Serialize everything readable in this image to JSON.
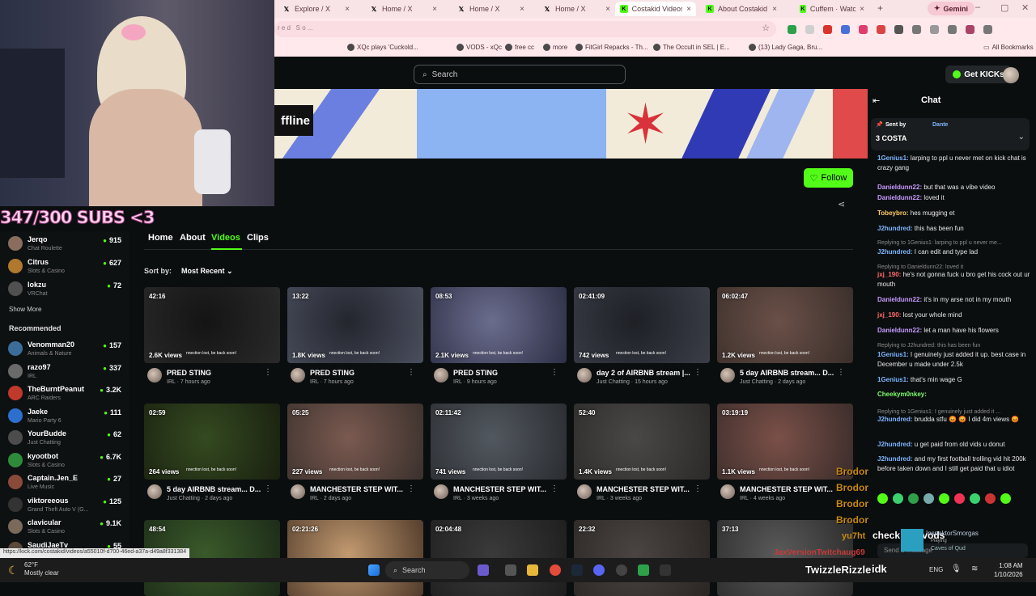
{
  "tabs": [
    {
      "label": "Explore / X",
      "icon": "x-icon"
    },
    {
      "label": "Home / X",
      "icon": "x-icon"
    },
    {
      "label": "Home / X",
      "icon": "x-icon"
    },
    {
      "label": "Home / X",
      "icon": "x-icon"
    },
    {
      "label": "Costakid Videos",
      "icon": "kick-icon"
    },
    {
      "label": "About Costakid",
      "icon": "kick-icon"
    },
    {
      "label": "Cuffem · Watch cl",
      "icon": "kick-icon"
    }
  ],
  "gemini_label": "Gemini",
  "bookmarks": [
    "XQc plays 'Cuckold...",
    "VODS - xQc",
    "free cc",
    "more",
    "FitGirl Repacks - Th...",
    "The Occult in SEL | E...",
    "(13) Lady Gaga, Bru...",
    "All Bookmarks"
  ],
  "search_placeholder": "Search",
  "get_kicks": "Get KICKs",
  "offline_text": "ffline",
  "follow_label": "Follow",
  "nav_tabs": [
    "Home",
    "About",
    "Videos",
    "Clips"
  ],
  "active_tab": "Videos",
  "sort_label": "Sort by:",
  "sort_value": "Most Recent",
  "videos": [
    {
      "duration": "42:16",
      "views": "2.6K views",
      "title": "PRED STING",
      "sub": "IRL · 7 hours ago"
    },
    {
      "duration": "13:22",
      "views": "1.8K views",
      "title": "PRED STING",
      "sub": "IRL · 7 hours ago"
    },
    {
      "duration": "08:53",
      "views": "2.1K views",
      "title": "PRED STING",
      "sub": "IRL · 9 hours ago"
    },
    {
      "duration": "02:41:09",
      "views": "742 views",
      "title": "day 2 of AIRBNB stream |...",
      "sub": "Just Chatting · 15 hours ago"
    },
    {
      "duration": "06:02:47",
      "views": "1.2K views",
      "title": "5 day AIRBNB stream... D...",
      "sub": "Just Chatting · 2 days ago"
    },
    {
      "duration": "02:59",
      "views": "264 views",
      "title": "5 day AIRBNB stream... D...",
      "sub": "Just Chatting · 2 days ago"
    },
    {
      "duration": "05:25",
      "views": "227 views",
      "title": "MANCHESTER STEP WIT...",
      "sub": "IRL · 2 days ago"
    },
    {
      "duration": "02:11:42",
      "views": "741 views",
      "title": "MANCHESTER STEP WIT...",
      "sub": "IRL · 3 weeks ago"
    },
    {
      "duration": "52:40",
      "views": "1.4K views",
      "title": "MANCHESTER STEP WIT...",
      "sub": "IRL · 3 weeks ago"
    },
    {
      "duration": "03:19:19",
      "views": "1.1K views",
      "title": "MANCHESTER STEP WIT...",
      "sub": "IRL · 4 weeks ago"
    },
    {
      "duration": "48:54",
      "views": "",
      "title": "",
      "sub": ""
    },
    {
      "duration": "02:21:26",
      "views": "",
      "title": "",
      "sub": ""
    },
    {
      "duration": "02:04:48",
      "views": "",
      "title": "",
      "sub": ""
    },
    {
      "duration": "22:32",
      "views": "",
      "title": "",
      "sub": ""
    },
    {
      "duration": "37:13",
      "views": "",
      "title": "",
      "sub": ""
    }
  ],
  "thumb_caption": "nnection lost, be back soon!",
  "chat": {
    "title": "Chat",
    "pinned_sent_by": "Sent by",
    "pinned_user": "Dante",
    "pinned_text": "3 COSTA",
    "input_placeholder": "Send a message",
    "messages": [
      {
        "user": "1Genius1:",
        "text": "larping to ppl u never met on kick chat is crazy gang",
        "color": "#7bb6ff",
        "reply": false
      },
      {
        "user": "Danieldunn22:",
        "text": "but that was a vibe video",
        "color": "#c79bff",
        "reply": false
      },
      {
        "user": "Danieldunn22:",
        "text": "loved it",
        "color": "#c79bff",
        "reply": false
      },
      {
        "user": "Tobeybro:",
        "text": "hes mugging et",
        "color": "#ffcc66",
        "reply": false
      },
      {
        "user": "J2hundred:",
        "text": "this has been fun",
        "color": "#7bb6ff",
        "reply": false
      },
      {
        "user": "",
        "text": "Replying to 1Genius1: larping to ppl u never me...",
        "color": "#8b8b8b",
        "reply": true
      },
      {
        "user": "J2hundred:",
        "text": "I can edit and type lad",
        "color": "#7bb6ff",
        "reply": false
      },
      {
        "user": "",
        "text": "Replying to Danieldunn22: loved it",
        "color": "#8b8b8b",
        "reply": true
      },
      {
        "user": "jxj_190:",
        "text": "he's not gonna fuck u bro get his cock out ur mouth",
        "color": "#ff6b6b",
        "reply": false
      },
      {
        "user": "Danieldunn22:",
        "text": "it's in my arse not in my mouth",
        "color": "#c79bff",
        "reply": false
      },
      {
        "user": "jxj_190:",
        "text": "lost your whole mind",
        "color": "#ff6b6b",
        "reply": false
      },
      {
        "user": "Danieldunn22:",
        "text": "let a man have his flowers",
        "color": "#c79bff",
        "reply": false
      },
      {
        "user": "",
        "text": "Replying to J2hundred: this has been fun",
        "color": "#8b8b8b",
        "reply": true
      },
      {
        "user": "1Genius1:",
        "text": "I genuinely just added it up. best case in December u made under 2.5k",
        "color": "#7bb6ff",
        "reply": false
      },
      {
        "user": "1Genius1:",
        "text": "that's min wage G",
        "color": "#7bb6ff",
        "reply": false
      },
      {
        "user": "Cheekym0nkey:",
        "text": "",
        "color": "#7cfc6a",
        "reply": false
      },
      {
        "user": "",
        "text": "Replying to 1Genius1: I genuinely just added it ...",
        "color": "#8b8b8b",
        "reply": true
      },
      {
        "user": "J2hundred:",
        "text": "brudda stfu 😡 😡 I did 4m views 😡",
        "color": "#7bb6ff",
        "reply": false
      },
      {
        "user": "J2hundred:",
        "text": "u get paid from old vids u donut",
        "color": "#7bb6ff",
        "reply": false
      },
      {
        "user": "J2hundred:",
        "text": "and my first football trolling vid hit 200k before taken down and I still get paid that u idiot",
        "color": "#7bb6ff",
        "reply": false
      }
    ]
  },
  "subs_text": "347/300 SUBS <3",
  "sidebar": {
    "following": [
      {
        "name": "Jerqo",
        "game": "Chat Roulette",
        "viewers": "915",
        "color": "#8a6d5c"
      },
      {
        "name": "Citrus",
        "game": "Slots & Casino",
        "viewers": "627",
        "color": "#b0792e"
      },
      {
        "name": "lokzu",
        "game": "VRChat",
        "viewers": "72",
        "color": "#505050"
      }
    ],
    "show_more": "Show More",
    "recommended_label": "Recommended",
    "recommended": [
      {
        "name": "Venomman20",
        "game": "Animals & Nature",
        "viewers": "157",
        "color": "#3b6d9a"
      },
      {
        "name": "razo97",
        "game": "IRL",
        "viewers": "337",
        "color": "#6a6a6a"
      },
      {
        "name": "TheBurntPeanut",
        "game": "ARC Raiders",
        "viewers": "3.2K",
        "color": "#c0392b"
      },
      {
        "name": "Jaeke",
        "game": "Mario Party 6",
        "viewers": "111",
        "color": "#2d6fcf"
      },
      {
        "name": "YourBudde",
        "game": "Just Chatting",
        "viewers": "62",
        "color": "#4c4c4c"
      },
      {
        "name": "kyootbot",
        "game": "Slots & Casino",
        "viewers": "6.7K",
        "color": "#2e8b3a"
      },
      {
        "name": "Captain.Jen_E",
        "game": "Live Music",
        "viewers": "27",
        "color": "#8a4a3a"
      },
      {
        "name": "viktoreeous",
        "game": "Grand Theft Auto V (G...",
        "viewers": "125",
        "color": "#333333"
      },
      {
        "name": "clavicular",
        "game": "Slots & Casino",
        "viewers": "9.1K",
        "color": "#7a6a5a"
      },
      {
        "name": "SaudiJaeTv",
        "game": "",
        "viewers": "55",
        "color": "#5a4a3a"
      }
    ]
  },
  "brodor": [
    "Brodor",
    "Brodor",
    "Brodor",
    "Brodor"
  ],
  "yu7ht": "yu7ht",
  "check_last_vods": "check last vods",
  "inspector": "InspektorSmorgas",
  "inspector_sub": "Playing",
  "inspector_game": "Caves of Qud",
  "overlay_name": "JaxVersionTwitchaug69",
  "status_url": "https://kick.com/costakid/videos/a55010f-d700-46ed-a37a-d49a8f331384",
  "taskbar": {
    "weather_temp": "62°F",
    "weather_desc": "Mostly clear",
    "search": "Search",
    "lang": "ENG",
    "time": "1:08 AM",
    "date": "1/10/2026"
  },
  "twizzle": "TwizzleRizzle",
  "idk": "idk"
}
